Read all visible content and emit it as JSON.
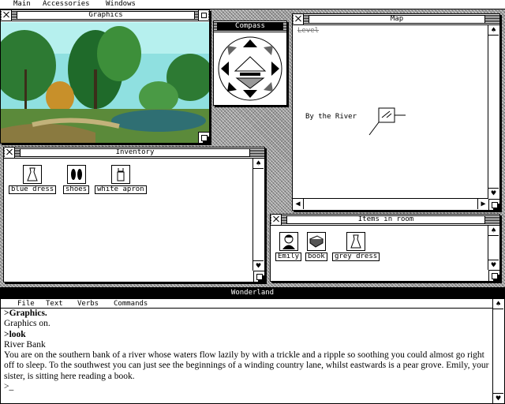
{
  "menubar": {
    "main": "Main",
    "accessories": "Accessories",
    "windows": "Windows"
  },
  "graphics": {
    "title": "Graphics"
  },
  "compass": {
    "title": "Compass"
  },
  "map": {
    "title": "Map",
    "level": "Level",
    "location": "By the River"
  },
  "inventory": {
    "title": "Inventory",
    "items": [
      {
        "label": "blue dress",
        "icon": "dress-icon"
      },
      {
        "label": "shoes",
        "icon": "shoes-icon"
      },
      {
        "label": "white apron",
        "icon": "apron-icon"
      }
    ]
  },
  "room": {
    "title": "Items in room",
    "items": [
      {
        "label": "Emily",
        "icon": "person-icon"
      },
      {
        "label": "book",
        "icon": "book-icon"
      },
      {
        "label": "grey dress",
        "icon": "dress-icon"
      }
    ]
  },
  "wonderland": {
    "title": "Wonderland",
    "menu": {
      "file": "File",
      "text": "Text",
      "verbs": "Verbs",
      "commands": "Commands"
    },
    "transcript": {
      "cmd1": "Graphics.",
      "out1": "Graphics on.",
      "cmd2": "look",
      "room": "River Bank",
      "desc": "You are on the southern bank of a river whose waters flow lazily by with a trickle and a ripple so soothing you could almost go right off to sleep. To the southwest you can just see the beginnings of a winding country lane, whilst eastwards is a pear grove. Emily, your sister, is sitting here reading a book.",
      "prompt": ">",
      "cursor": "_"
    }
  },
  "colors": {
    "sky": "#8fe0e0",
    "tree": "#1f6a2a",
    "foliage": "#3d8f3a",
    "water": "#2f6f73",
    "ground": "#8a7a40"
  }
}
